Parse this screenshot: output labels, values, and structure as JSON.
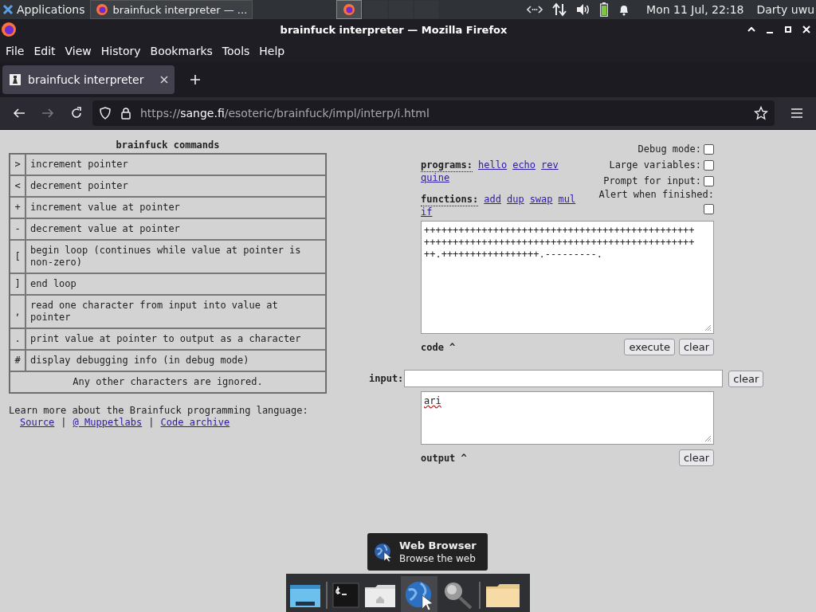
{
  "top_panel": {
    "applications": "Applications",
    "window_button": "brainfuck interpreter — ...",
    "clock": "Mon 11 Jul, 22:18",
    "user": "Darty uwu"
  },
  "window": {
    "title": "brainfuck interpreter — Mozilla Firefox"
  },
  "menu": [
    "File",
    "Edit",
    "View",
    "History",
    "Bookmarks",
    "Tools",
    "Help"
  ],
  "tabs": [
    {
      "label": "brainfuck interpreter",
      "selected": true
    }
  ],
  "url": {
    "scheme": "https://",
    "host": "sange.fi",
    "path": "/esoteric/brainfuck/impl/interp/i.html"
  },
  "commands": {
    "title": "brainfuck commands",
    "rows": [
      {
        "symbol": ">",
        "description": "increment pointer"
      },
      {
        "symbol": "<",
        "description": "decrement pointer"
      },
      {
        "symbol": "+",
        "description": "increment value at pointer"
      },
      {
        "symbol": "-",
        "description": "decrement value at pointer"
      },
      {
        "symbol": "[",
        "description": "begin loop (continues while value at pointer is non-zero)"
      },
      {
        "symbol": "]",
        "description": "end loop"
      },
      {
        "symbol": ",",
        "description": "read one character from input into value at pointer"
      },
      {
        "symbol": ".",
        "description": "print value at pointer to output as a character"
      },
      {
        "symbol": "#",
        "description": "display debugging info (in debug mode)"
      }
    ],
    "footer": "Any other characters are ignored."
  },
  "learn_more": {
    "text": "Learn more about the Brainfuck programming language:",
    "separator": "|",
    "links": [
      "Source",
      "@ Muppetlabs",
      "Code archive"
    ]
  },
  "programs": {
    "label": "programs:",
    "links": [
      "hello",
      "echo",
      "rev",
      "quine"
    ]
  },
  "functions": {
    "label": "functions:",
    "links": [
      "add",
      "dup",
      "swap",
      "mul",
      "if"
    ]
  },
  "options": [
    {
      "label": "Debug mode:",
      "checked": false
    },
    {
      "label": "Large variables:",
      "checked": false
    },
    {
      "label": "Prompt for input:",
      "checked": false
    },
    {
      "label": "Alert when finished:",
      "checked": false
    }
  ],
  "code": {
    "value": "++++++++++++++++++++++++++++++++++++++++++++++++++++++++++++++++++++++++++++++++++++++++++++++++.+++++++++++++++++.---------.",
    "label": "code ^",
    "buttons": [
      "execute",
      "clear"
    ]
  },
  "input": {
    "label": "input:",
    "button": "clear"
  },
  "output": {
    "value": "ari",
    "label": "output ^",
    "button": "clear"
  },
  "tooltip": {
    "title": "Web Browser",
    "subtitle": "Browse the web"
  }
}
